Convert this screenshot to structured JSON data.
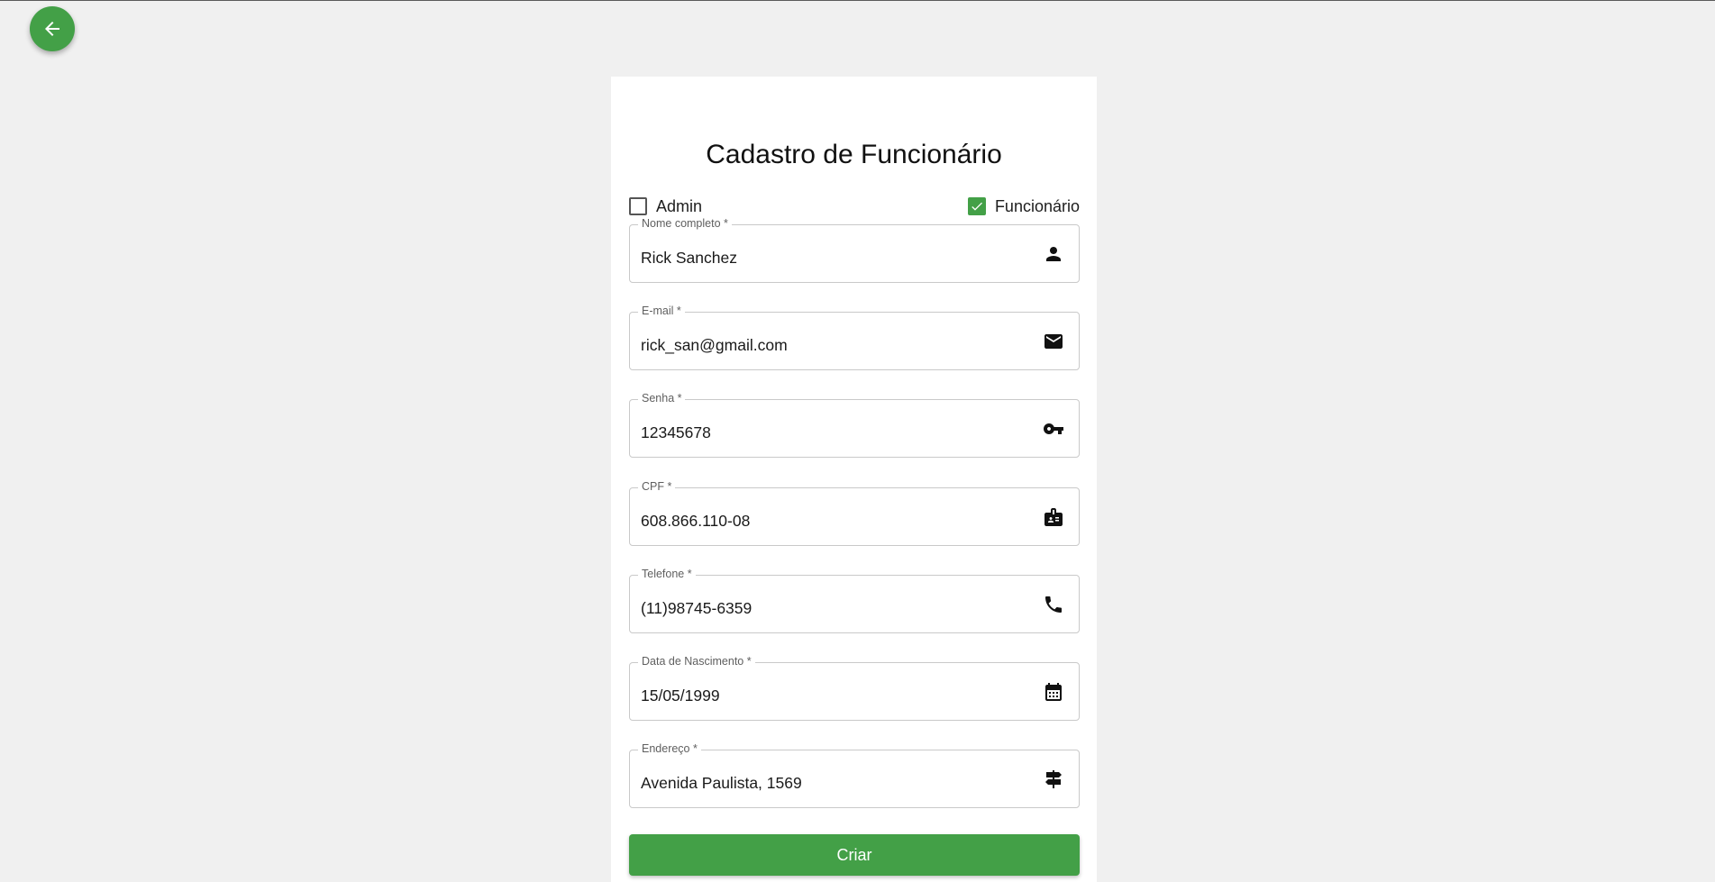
{
  "page": {
    "title": "Cadastro de Funcionário",
    "back_icon": "arrow-left-icon",
    "accent_color": "#43a047"
  },
  "roles": [
    {
      "label": "Admin",
      "checked": false
    },
    {
      "label": "Funcionário",
      "checked": true
    }
  ],
  "fields": {
    "name": {
      "label": "Nome completo *",
      "value": "Rick Sanchez",
      "icon": "person-icon"
    },
    "email": {
      "label": "E-mail *",
      "value": "rick_san@gmail.com",
      "icon": "mail-icon"
    },
    "password": {
      "label": "Senha *",
      "value": "12345678",
      "icon": "key-icon"
    },
    "cpf": {
      "label": "CPF *",
      "value": "608.866.110-08",
      "icon": "id-badge-icon"
    },
    "phone": {
      "label": "Telefone *",
      "value": "(11)98745-6359",
      "icon": "phone-icon"
    },
    "birthdate": {
      "label": "Data de Nascimento *",
      "value": "15/05/1999",
      "icon": "calendar-icon"
    },
    "address": {
      "label": "Endereço *",
      "value": "Avenida Paulista, 1569",
      "icon": "signpost-icon"
    }
  },
  "submit_label": "Criar"
}
